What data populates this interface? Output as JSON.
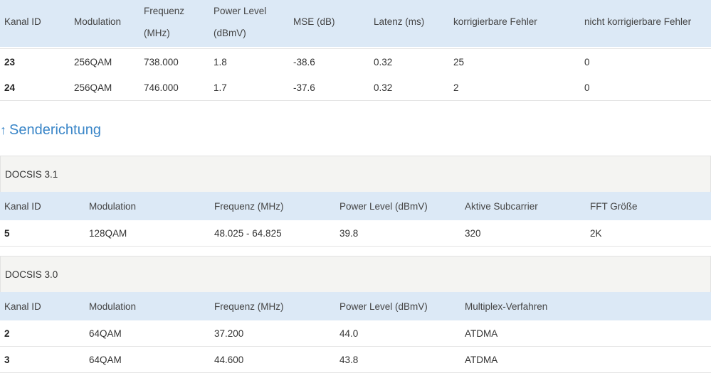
{
  "downstream": {
    "headers": [
      "Kanal ID",
      "Modulation",
      "Frequenz",
      "(MHz)",
      "Power Level",
      "(dBmV)",
      "MSE (dB)",
      "Latenz (ms)",
      "korrigierbare Fehler",
      "nicht korrigierbare Fehler"
    ],
    "rows": [
      [
        "23",
        "256QAM",
        "738.000",
        "1.8",
        "-38.6",
        "0.32",
        "25",
        "0"
      ],
      [
        "24",
        "256QAM",
        "746.000",
        "1.7",
        "-37.6",
        "0.32",
        "2",
        "0"
      ]
    ]
  },
  "upstream": {
    "arrow": "↑",
    "title": "Senderichtung",
    "docsis31": {
      "label": "DOCSIS 3.1",
      "headers": [
        "Kanal ID",
        "Modulation",
        "Frequenz (MHz)",
        "Power Level (dBmV)",
        "Aktive Subcarrier",
        "FFT Größe"
      ],
      "rows": [
        [
          "5",
          "128QAM",
          "48.025 - 64.825",
          "39.8",
          "320",
          "2K"
        ]
      ]
    },
    "docsis30": {
      "label": "DOCSIS 3.0",
      "headers": [
        "Kanal ID",
        "Modulation",
        "Frequenz (MHz)",
        "Power Level (dBmV)",
        "Multiplex-Verfahren"
      ],
      "rows": [
        [
          "2",
          "64QAM",
          "37.200",
          "44.0",
          "ATDMA"
        ],
        [
          "3",
          "64QAM",
          "44.600",
          "43.8",
          "ATDMA"
        ]
      ]
    }
  }
}
